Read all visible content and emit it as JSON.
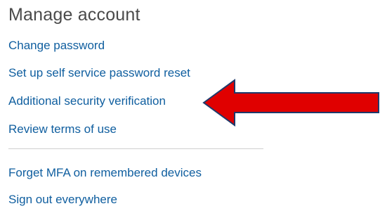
{
  "manage_account": {
    "title": "Manage account",
    "links": [
      "Change password",
      "Set up self service password reset",
      "Additional security verification",
      "Review terms of use"
    ],
    "links_secondary": [
      "Forget MFA on remembered devices",
      "Sign out everywhere"
    ]
  },
  "colors": {
    "link": "#0f5e9f",
    "title": "#4a4a4a",
    "arrow_fill": "#e00000",
    "arrow_stroke": "#1f3a6b",
    "divider": "#cfcfcf"
  },
  "annotation": {
    "icon": "arrow-left-icon"
  }
}
